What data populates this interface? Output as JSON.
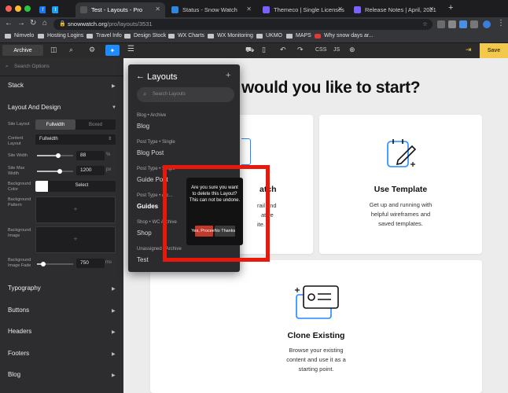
{
  "browser": {
    "tabs": [
      {
        "label": "Test - Layouts - Pro",
        "active": true
      },
      {
        "label": "Status - Snow Watch"
      },
      {
        "label": "Themeco | Single Licenses"
      },
      {
        "label": "Release Notes | April, 2021"
      }
    ],
    "new_tab": "+",
    "url_domain": "snowwatch.org",
    "url_path": "/pro/layouts/3531",
    "bookmarks": [
      "Nimvelo",
      "Hosting Logins",
      "Travel Info",
      "Design Stock",
      "WX Charts",
      "WX Monitoring",
      "UKMO",
      "MAPS",
      "Why snow days ar..."
    ]
  },
  "toolbar": {
    "archive": "Archive",
    "css": "CSS",
    "js": "JS",
    "save": "Save"
  },
  "sidebar": {
    "search_placeholder": "Search Options",
    "stack": "Stack",
    "layout_and_design": "Layout And Design",
    "site_layout_label": "Site Layout",
    "fullwidth": "Fullwidth",
    "boxed": "Boxed",
    "content_layout_label": "Content Layout",
    "content_layout_value": "Fullwidth",
    "site_width_label": "Site Width",
    "site_width_value": "88",
    "site_width_unit": "%",
    "site_max_width_label": "Site Max Width",
    "site_max_width_value": "1200",
    "site_max_width_unit": "px",
    "bg_color_label": "Background Color",
    "bg_color_select": "Select",
    "bg_pattern_label": "Background Pattern",
    "bg_image_label": "Background Image",
    "bg_image_fade_label": "Background Image Fade",
    "bg_image_fade_value": "750",
    "bg_image_fade_unit": "ms",
    "typography": "Typography",
    "buttons": "Buttons",
    "headers": "Headers",
    "footers": "Footers",
    "blog": "Blog"
  },
  "main": {
    "heading": "would you like to start?",
    "cards": {
      "left_title": "atch",
      "left_desc_line1": "rail and",
      "left_desc_line2": "ative",
      "left_desc_line3": "ite.",
      "use_template_title": "Use Template",
      "use_template_desc": [
        "Get up and running with",
        "helpful wireframes and",
        "saved templates."
      ],
      "clone_title": "Clone Existing",
      "clone_desc": [
        "Browse your existing",
        "content and use it as a",
        "starting point."
      ]
    }
  },
  "layouts_panel": {
    "title": "Layouts",
    "search_placeholder": "Search Layouts",
    "groups": [
      {
        "category": "Blog • Archive",
        "item": "Blog"
      },
      {
        "category": "Post Type • Single",
        "item": "Blog Post"
      },
      {
        "category": "Post Type • Single",
        "item": "Guide Post"
      },
      {
        "category": "Post Type • Arc...",
        "item": "Guides"
      },
      {
        "category": "Shop • WC Archive",
        "item": "Shop"
      },
      {
        "category": "Unassigned • Archive",
        "item": "Test"
      }
    ]
  },
  "confirm_dialog": {
    "message": "Are you sure you want to delete this Layout? This can not be undone.",
    "yes": "Yes, Proceed",
    "no": "No Thanks"
  },
  "colors": {
    "accent": "#1e8bff",
    "save": "#f2c94c",
    "highlight": "#e8190a"
  }
}
